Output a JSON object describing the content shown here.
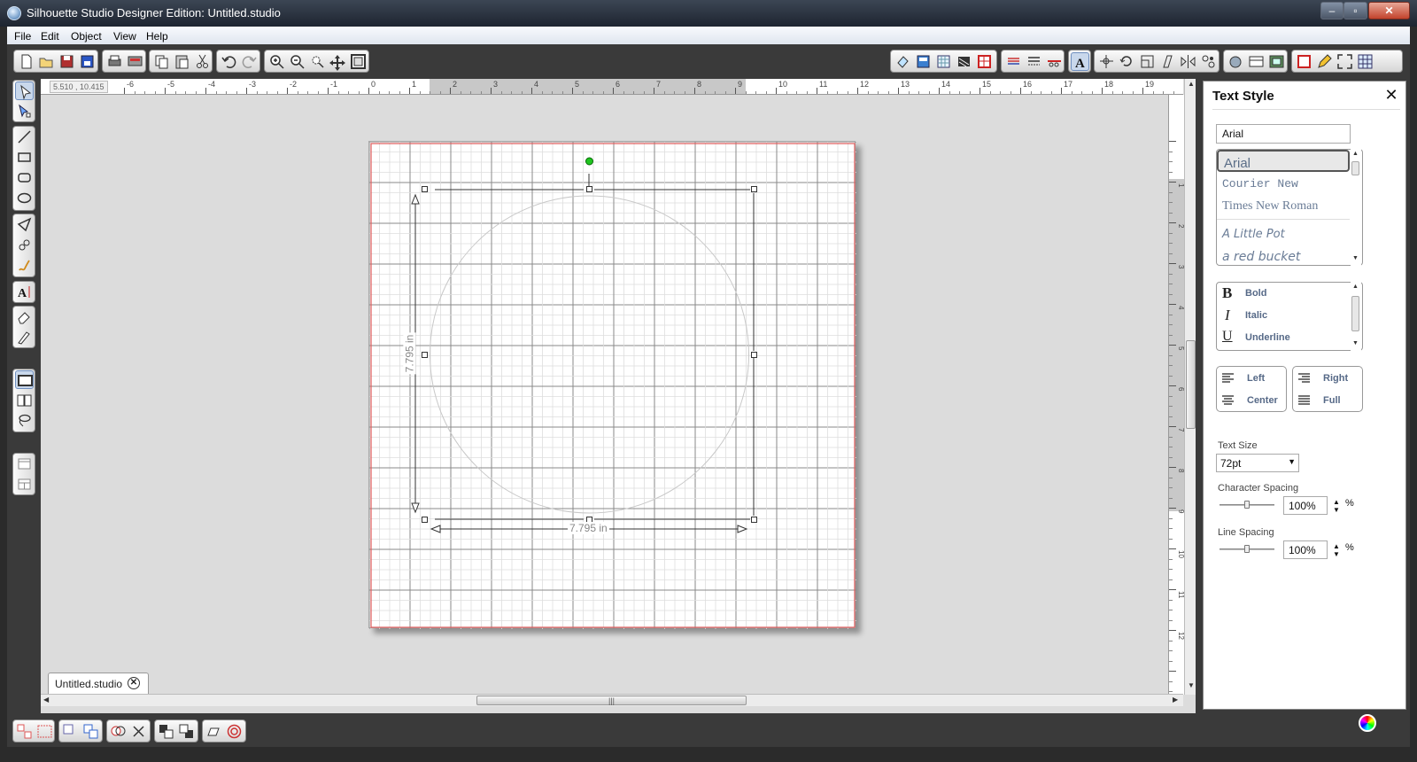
{
  "window": {
    "title": "Silhouette Studio Designer Edition: Untitled.studio"
  },
  "menu": [
    "File",
    "Edit",
    "Object",
    "View",
    "Help"
  ],
  "ruler": {
    "coordinates": "5.510 , 10.415",
    "h_labels": [
      "-6",
      "-5",
      "-4",
      "-3",
      "-2",
      "-1",
      "0",
      "1",
      "2",
      "3",
      "4",
      "5",
      "6",
      "7",
      "8",
      "9",
      "10",
      "11",
      "12",
      "13",
      "14",
      "15",
      "16",
      "17",
      "18",
      "19"
    ],
    "v_labels": [
      "1",
      "2",
      "3",
      "4",
      "5",
      "6",
      "7",
      "8",
      "9",
      "10",
      "11",
      "12"
    ]
  },
  "canvas": {
    "width_label": "7.795 in",
    "height_label": "7.795 in",
    "colors": {
      "mat_border": "#e05a5a",
      "grid": "#b8b8b8",
      "rotate_handle": "#1fc41f"
    }
  },
  "document_tab": {
    "label": "Untitled.studio"
  },
  "text_style_panel": {
    "title": "Text Style",
    "font_field": "Arial",
    "fonts": [
      "Arial",
      "Courier New",
      "Times New Roman",
      "A Little Pot",
      "a red bucket"
    ],
    "selected_font": "Arial",
    "styles": [
      {
        "glyph": "B",
        "label": "Bold"
      },
      {
        "glyph": "I",
        "label": "Italic"
      },
      {
        "glyph": "U",
        "label": "Underline"
      }
    ],
    "alignment": {
      "left": "Left",
      "center": "Center",
      "right": "Right",
      "full": "Full"
    },
    "text_size": {
      "label": "Text Size",
      "value": "72pt"
    },
    "character_spacing": {
      "label": "Character Spacing",
      "value": "100%",
      "unit": "%"
    },
    "line_spacing": {
      "label": "Line Spacing",
      "value": "100%",
      "unit": "%"
    }
  },
  "toolbar_icons": [
    "new-document-icon",
    "open-icon",
    "save-icon",
    "save-to-library-icon",
    "print-icon",
    "print-cut-icon",
    "copy-icon",
    "paste-icon",
    "cut-icon",
    "undo-icon",
    "redo-icon",
    "zoom-in-icon",
    "zoom-out-icon",
    "zoom-select-icon",
    "pan-icon",
    "fit-to-page-icon"
  ]
}
